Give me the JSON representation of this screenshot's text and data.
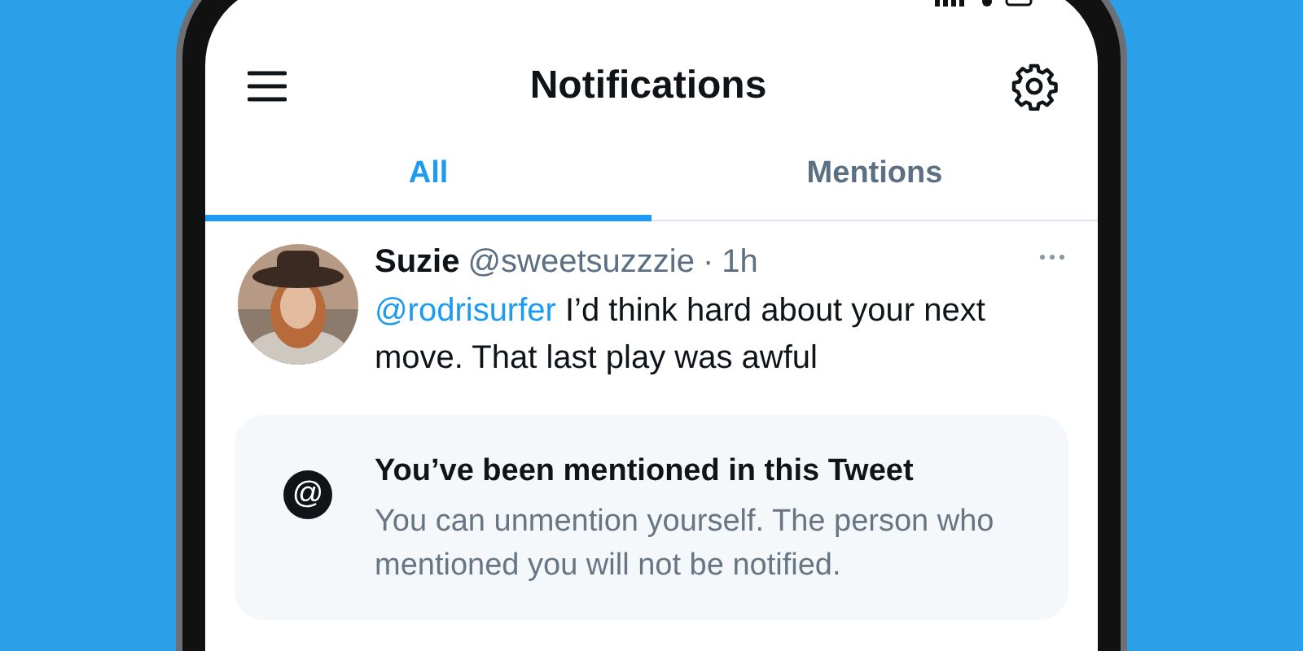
{
  "header": {
    "title": "Notifications"
  },
  "tabs": [
    {
      "label": "All",
      "selected": true
    },
    {
      "label": "Mentions",
      "selected": false
    }
  ],
  "tweet": {
    "author": "Suzie",
    "handle": "@sweetsuzzzie",
    "separator": "·",
    "time": "1h",
    "mention": "@rodrisurfer",
    "text": "I’d think hard about your next move. That last play was awful"
  },
  "notice": {
    "icon": "@",
    "title": "You’ve been mentioned in this Tweet",
    "body": "You can unmention yourself. The person who mentioned you will not be notified."
  }
}
